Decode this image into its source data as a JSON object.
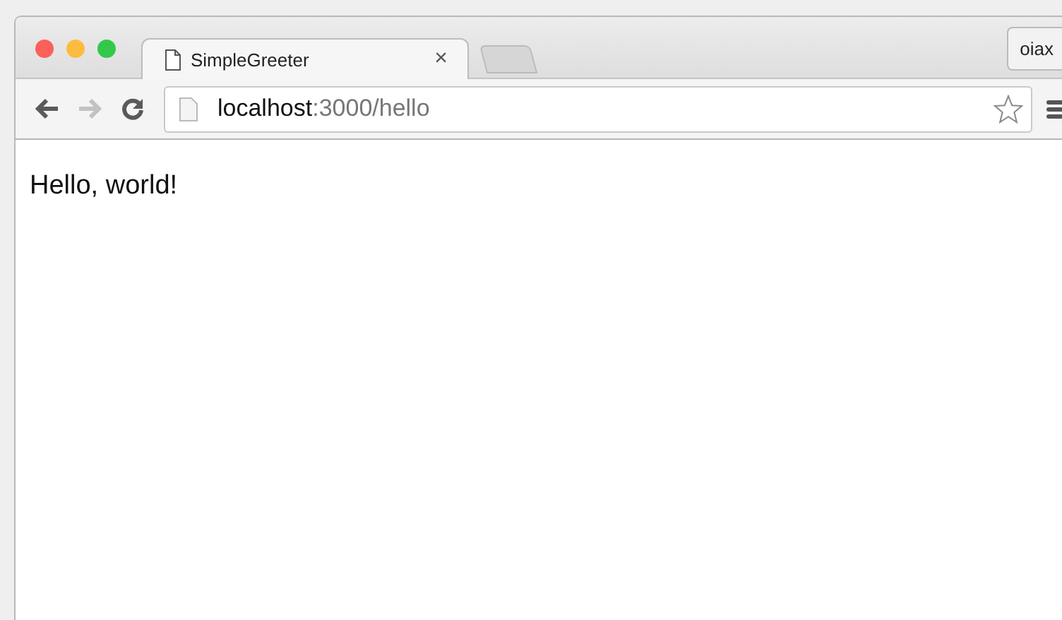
{
  "tabs": [
    {
      "title": "SimpleGreeter",
      "close": "×",
      "selected": true
    }
  ],
  "profile": {
    "label": "oiax"
  },
  "toolbar": {
    "back": {
      "disabled": false
    },
    "forward": {
      "disabled": true
    },
    "url": {
      "host": "localhost",
      "rest": ":3000/hello"
    }
  },
  "page": {
    "text": "Hello, world!"
  }
}
